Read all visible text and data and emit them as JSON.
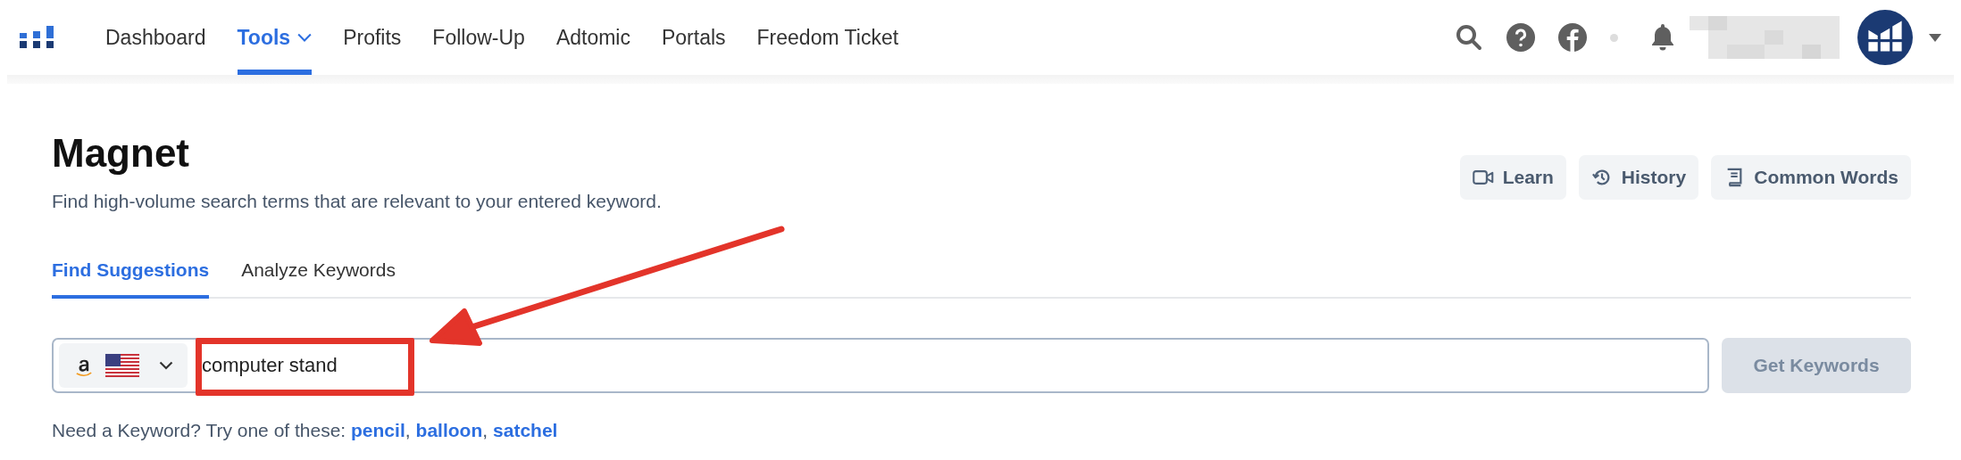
{
  "nav": {
    "items": [
      {
        "label": "Dashboard",
        "selected": false,
        "dropdown": false
      },
      {
        "label": "Tools",
        "selected": true,
        "dropdown": true
      },
      {
        "label": "Profits",
        "selected": false,
        "dropdown": false
      },
      {
        "label": "Follow-Up",
        "selected": false,
        "dropdown": false
      },
      {
        "label": "Adtomic",
        "selected": false,
        "dropdown": false
      },
      {
        "label": "Portals",
        "selected": false,
        "dropdown": false
      },
      {
        "label": "Freedom Ticket",
        "selected": false,
        "dropdown": false
      }
    ]
  },
  "page": {
    "title": "Magnet",
    "subtitle": "Find high-volume search terms that are relevant to your entered keyword.",
    "actions": [
      {
        "label": "Learn",
        "kind": "video"
      },
      {
        "label": "History",
        "kind": "history"
      },
      {
        "label": "Common Words",
        "kind": "book"
      }
    ]
  },
  "tabs": [
    {
      "label": "Find Suggestions",
      "selected": true
    },
    {
      "label": "Analyze Keywords",
      "selected": false
    }
  ],
  "search": {
    "value": "computer stand",
    "button": "Get Keywords",
    "button_disabled": true
  },
  "hint": {
    "lead": "Need a Keyword? Try one of these:",
    "separator": ",",
    "links": [
      "pencil",
      "balloon",
      "satchel"
    ]
  }
}
